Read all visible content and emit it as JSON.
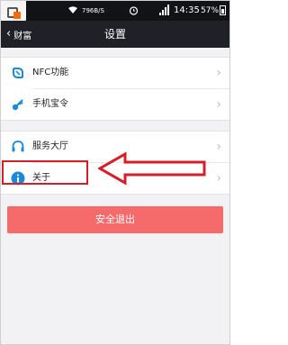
{
  "status_bar": {
    "speed": "796B/S",
    "time": "14:35",
    "battery": "57%"
  },
  "header": {
    "back_label": "财富",
    "back_icon": "‹",
    "title": "设置"
  },
  "groups": [
    {
      "items": [
        {
          "label": "NFC功能",
          "icon": "nfc-icon"
        },
        {
          "label": "手机宝令",
          "icon": "key-icon"
        }
      ]
    },
    {
      "items": [
        {
          "label": "服务大厅",
          "icon": "headset-icon"
        },
        {
          "label": "关于",
          "icon": "info-icon"
        }
      ]
    }
  ],
  "chevron": "›",
  "logout_label": "安全退出",
  "colors": {
    "header_bg": "#1f2126",
    "icon_blue": "#1b8ad8",
    "logout_bg": "#f56a6a",
    "annotation_red": "#d31f27"
  }
}
